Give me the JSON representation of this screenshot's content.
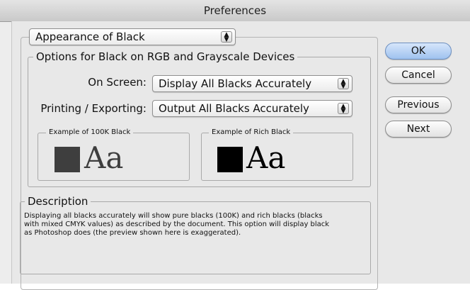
{
  "window": {
    "title": "Preferences"
  },
  "section_select": {
    "value": "Appearance of Black"
  },
  "options_group": {
    "legend": "Options for Black on RGB and Grayscale Devices",
    "on_screen": {
      "label": "On Screen:",
      "value": "Display All Blacks Accurately"
    },
    "printing": {
      "label": "Printing / Exporting:",
      "value": "Output All Blacks Accurately"
    },
    "example_100k": {
      "legend": "Example of 100K Black",
      "sample_text": "Aa",
      "color": "#3e3e3e"
    },
    "example_rich": {
      "legend": "Example of Rich Black",
      "sample_text": "Aa",
      "color": "#000000"
    }
  },
  "description": {
    "legend": "Description",
    "lines": [
      "Displaying all blacks accurately will show pure blacks (100K) and rich blacks (blacks",
      "with mixed CMYK values) as described by the document. This option will display black",
      "as Photoshop does (the preview shown here is exaggerated)."
    ]
  },
  "buttons": {
    "ok": "OK",
    "cancel": "Cancel",
    "previous": "Previous",
    "next": "Next"
  },
  "colors": {
    "default_button": "#9fc2ef",
    "window_bg": "#e8e8e8"
  }
}
